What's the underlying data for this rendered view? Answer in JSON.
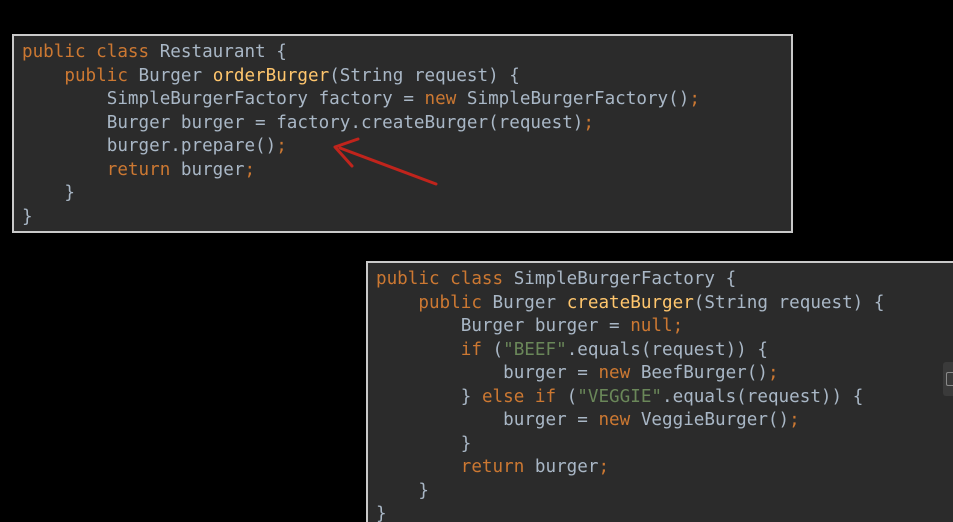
{
  "colors": {
    "background": "#000000",
    "panel_bg": "#2b2b2b",
    "panel_border": "#c9c9c9",
    "keyword": "#cc7832",
    "method": "#ffc66d",
    "string": "#6a8759",
    "plain": "#a9b7c6",
    "arrow": "#c0241c"
  },
  "restaurant_panel": {
    "lines": [
      [
        [
          "kw",
          "public"
        ],
        [
          "pl",
          " "
        ],
        [
          "kw",
          "class"
        ],
        [
          "pl",
          " Restaurant {"
        ]
      ],
      [
        [
          "pl",
          "    "
        ],
        [
          "kw",
          "public"
        ],
        [
          "pl",
          " Burger "
        ],
        [
          "fn",
          "orderBurger"
        ],
        [
          "pl",
          "(String request) {"
        ]
      ],
      [
        [
          "pl",
          "        SimpleBurgerFactory factory = "
        ],
        [
          "kw",
          "new"
        ],
        [
          "pl",
          " SimpleBurgerFactory()"
        ],
        [
          "kw",
          ";"
        ]
      ],
      [
        [
          "pl",
          "        Burger burger = factory.createBurger(request)"
        ],
        [
          "kw",
          ";"
        ]
      ],
      [
        [
          "pl",
          "        burger.prepare()"
        ],
        [
          "kw",
          ";"
        ]
      ],
      [
        [
          "pl",
          "        "
        ],
        [
          "kw",
          "return"
        ],
        [
          "pl",
          " burger"
        ],
        [
          "kw",
          ";"
        ]
      ],
      [
        [
          "pl",
          "    }"
        ]
      ],
      [
        [
          "pl",
          "}"
        ]
      ]
    ]
  },
  "factory_panel": {
    "lines": [
      [
        [
          "kw",
          "public"
        ],
        [
          "pl",
          " "
        ],
        [
          "kw",
          "class"
        ],
        [
          "pl",
          " SimpleBurgerFactory {"
        ]
      ],
      [
        [
          "pl",
          "    "
        ],
        [
          "kw",
          "public"
        ],
        [
          "pl",
          " Burger "
        ],
        [
          "fn",
          "createBurger"
        ],
        [
          "pl",
          "(String request) {"
        ]
      ],
      [
        [
          "pl",
          "        Burger burger = "
        ],
        [
          "kw",
          "null"
        ],
        [
          "kw",
          ";"
        ]
      ],
      [
        [
          "pl",
          "        "
        ],
        [
          "kw",
          "if"
        ],
        [
          "pl",
          " ("
        ],
        [
          "str",
          "\"BEEF\""
        ],
        [
          "pl",
          ".equals(request)) {"
        ]
      ],
      [
        [
          "pl",
          "            burger = "
        ],
        [
          "kw",
          "new"
        ],
        [
          "pl",
          " BeefBurger()"
        ],
        [
          "kw",
          ";"
        ]
      ],
      [
        [
          "pl",
          "        } "
        ],
        [
          "kw",
          "else if"
        ],
        [
          "pl",
          " ("
        ],
        [
          "str",
          "\"VEGGIE\""
        ],
        [
          "pl",
          ".equals(request)) {"
        ]
      ],
      [
        [
          "pl",
          "            burger = "
        ],
        [
          "kw",
          "new"
        ],
        [
          "pl",
          " VeggieBurger()"
        ],
        [
          "kw",
          ";"
        ]
      ],
      [
        [
          "pl",
          "        }"
        ]
      ],
      [
        [
          "pl",
          "        "
        ],
        [
          "kw",
          "return"
        ],
        [
          "pl",
          " burger"
        ],
        [
          "kw",
          ";"
        ]
      ],
      [
        [
          "pl",
          "    }"
        ]
      ],
      [
        [
          "pl",
          "}"
        ]
      ]
    ]
  }
}
